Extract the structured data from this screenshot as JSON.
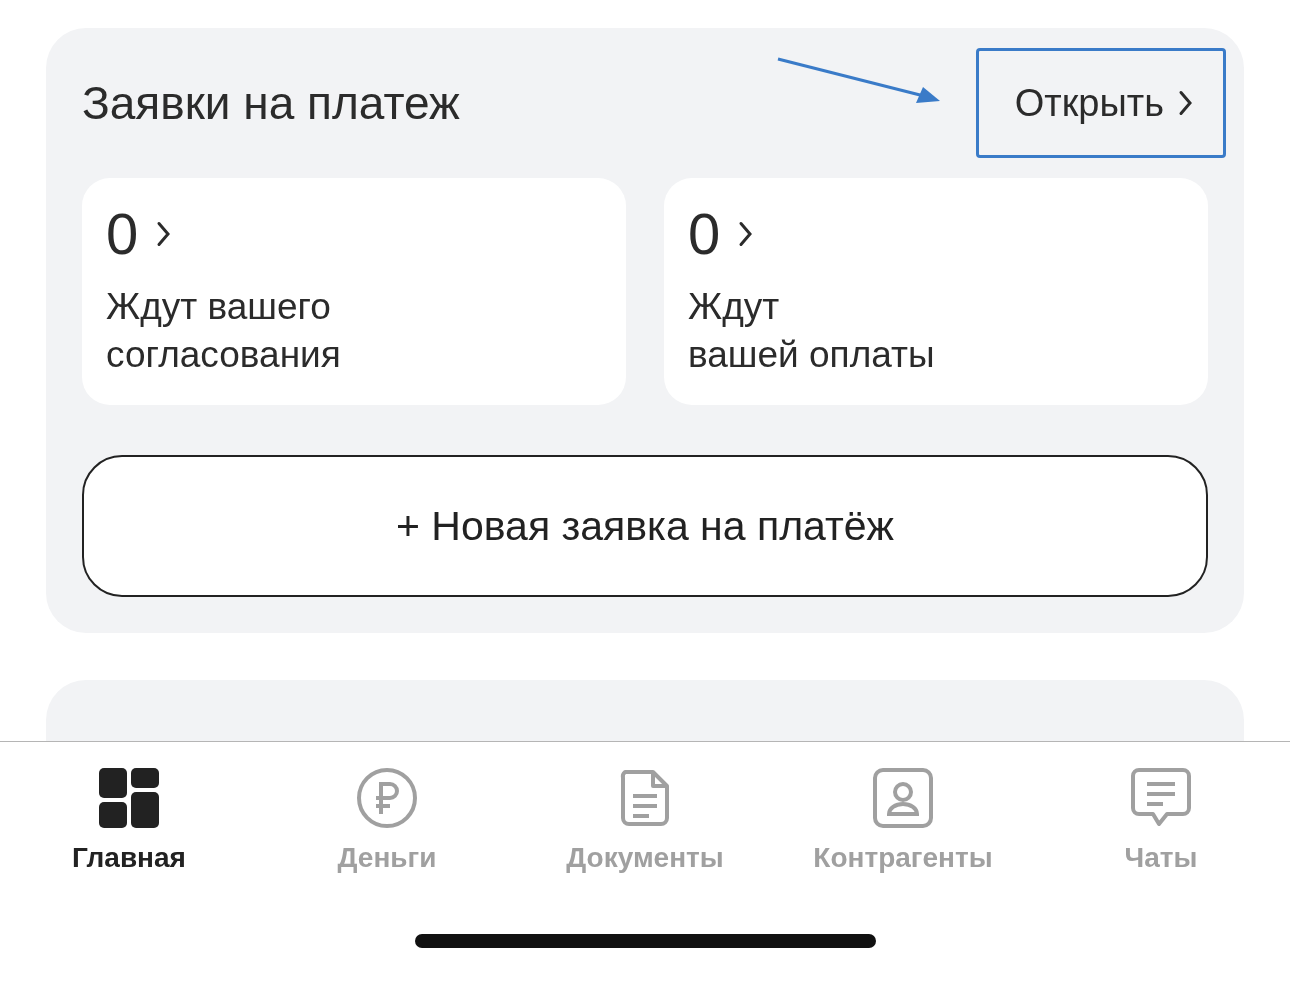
{
  "payment_requests": {
    "title": "Заявки на платеж",
    "open_button": {
      "label": "Открыть"
    },
    "stats": [
      {
        "count": "0",
        "label": "Ждут вашего\nсогласования"
      },
      {
        "count": "0",
        "label": "Ждут\nвашей оплаты"
      }
    ],
    "new_button": {
      "label": "+ Новая заявка на платёж"
    }
  },
  "tab_bar": {
    "tabs": [
      {
        "kind": "home",
        "label": "Главная",
        "selected": true
      },
      {
        "kind": "money",
        "label": "Деньги",
        "selected": false
      },
      {
        "kind": "documents",
        "label": "Документы",
        "selected": false
      },
      {
        "kind": "contacts",
        "label": "Контрагенты",
        "selected": false
      },
      {
        "kind": "chats",
        "label": "Чаты",
        "selected": false
      }
    ]
  }
}
